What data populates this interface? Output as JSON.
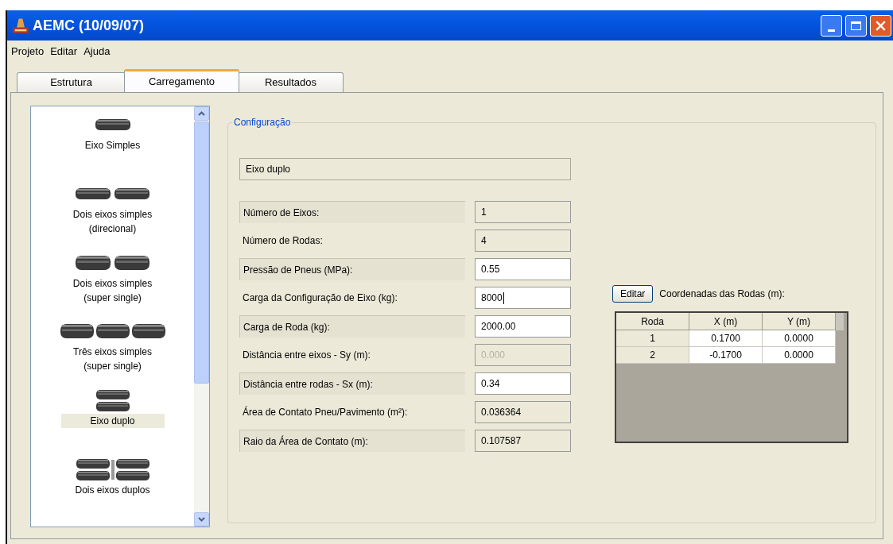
{
  "window": {
    "title": "AEMC (10/09/07)"
  },
  "menu": [
    "Projeto",
    "Editar",
    "Ajuda"
  ],
  "tabs": [
    {
      "label": "Estrutura",
      "selected": false
    },
    {
      "label": "Carregamento",
      "selected": true
    },
    {
      "label": "Resultados",
      "selected": false
    }
  ],
  "configurations": [
    {
      "label": "Eixo Simples",
      "kind": "single",
      "selected": false
    },
    {
      "label": "Dois eixos simples (direcional)",
      "kind": "pair",
      "selected": false
    },
    {
      "label": "Dois eixos simples (super single)",
      "kind": "pair_wide",
      "selected": false
    },
    {
      "label": "Três eixos simples (super single)",
      "kind": "triple",
      "selected": false
    },
    {
      "label": "Eixo duplo",
      "kind": "dual",
      "selected": true
    },
    {
      "label": "Dois eixos duplos",
      "kind": "dual_pair",
      "selected": false
    }
  ],
  "group": {
    "title": "Configuração",
    "configuration_name": "Eixo duplo",
    "fields": [
      {
        "label": "Número de Eixos:",
        "value": "1",
        "kind": "readonly",
        "focused": false
      },
      {
        "label": "Número de Rodas:",
        "value": "4",
        "kind": "readonly",
        "focused": false
      },
      {
        "label": "Pressão de Pneus (MPa):",
        "value": "0.55",
        "kind": "editable",
        "focused": false
      },
      {
        "label": "Carga da Configuração de Eixo (kg):",
        "value": "8000",
        "kind": "editable",
        "focused": true
      },
      {
        "label": "Carga de Roda (kg):",
        "value": "2000.00",
        "kind": "editable",
        "focused": false
      },
      {
        "label": "Distância entre eixos - Sy (m):",
        "value": "0.000",
        "kind": "disabled",
        "focused": false
      },
      {
        "label": "Distância entre rodas - Sx (m):",
        "value": "0.34",
        "kind": "editable",
        "focused": false
      },
      {
        "label": "Área de Contato Pneu/Pavimento (m²):",
        "value": "0.036364",
        "kind": "readonly",
        "focused": false
      },
      {
        "label": "Raio da Área de Contato (m):",
        "value": "0.107587",
        "kind": "readonly",
        "focused": false
      }
    ],
    "edit_button": "Editar",
    "coordinates_label": "Coordenadas das Rodas (m):",
    "table": {
      "columns": [
        "Roda",
        "X (m)",
        "Y (m)"
      ],
      "rows": [
        [
          "1",
          "0.1700",
          "0.0000"
        ],
        [
          "2",
          "-0.1700",
          "0.0000"
        ]
      ]
    }
  }
}
